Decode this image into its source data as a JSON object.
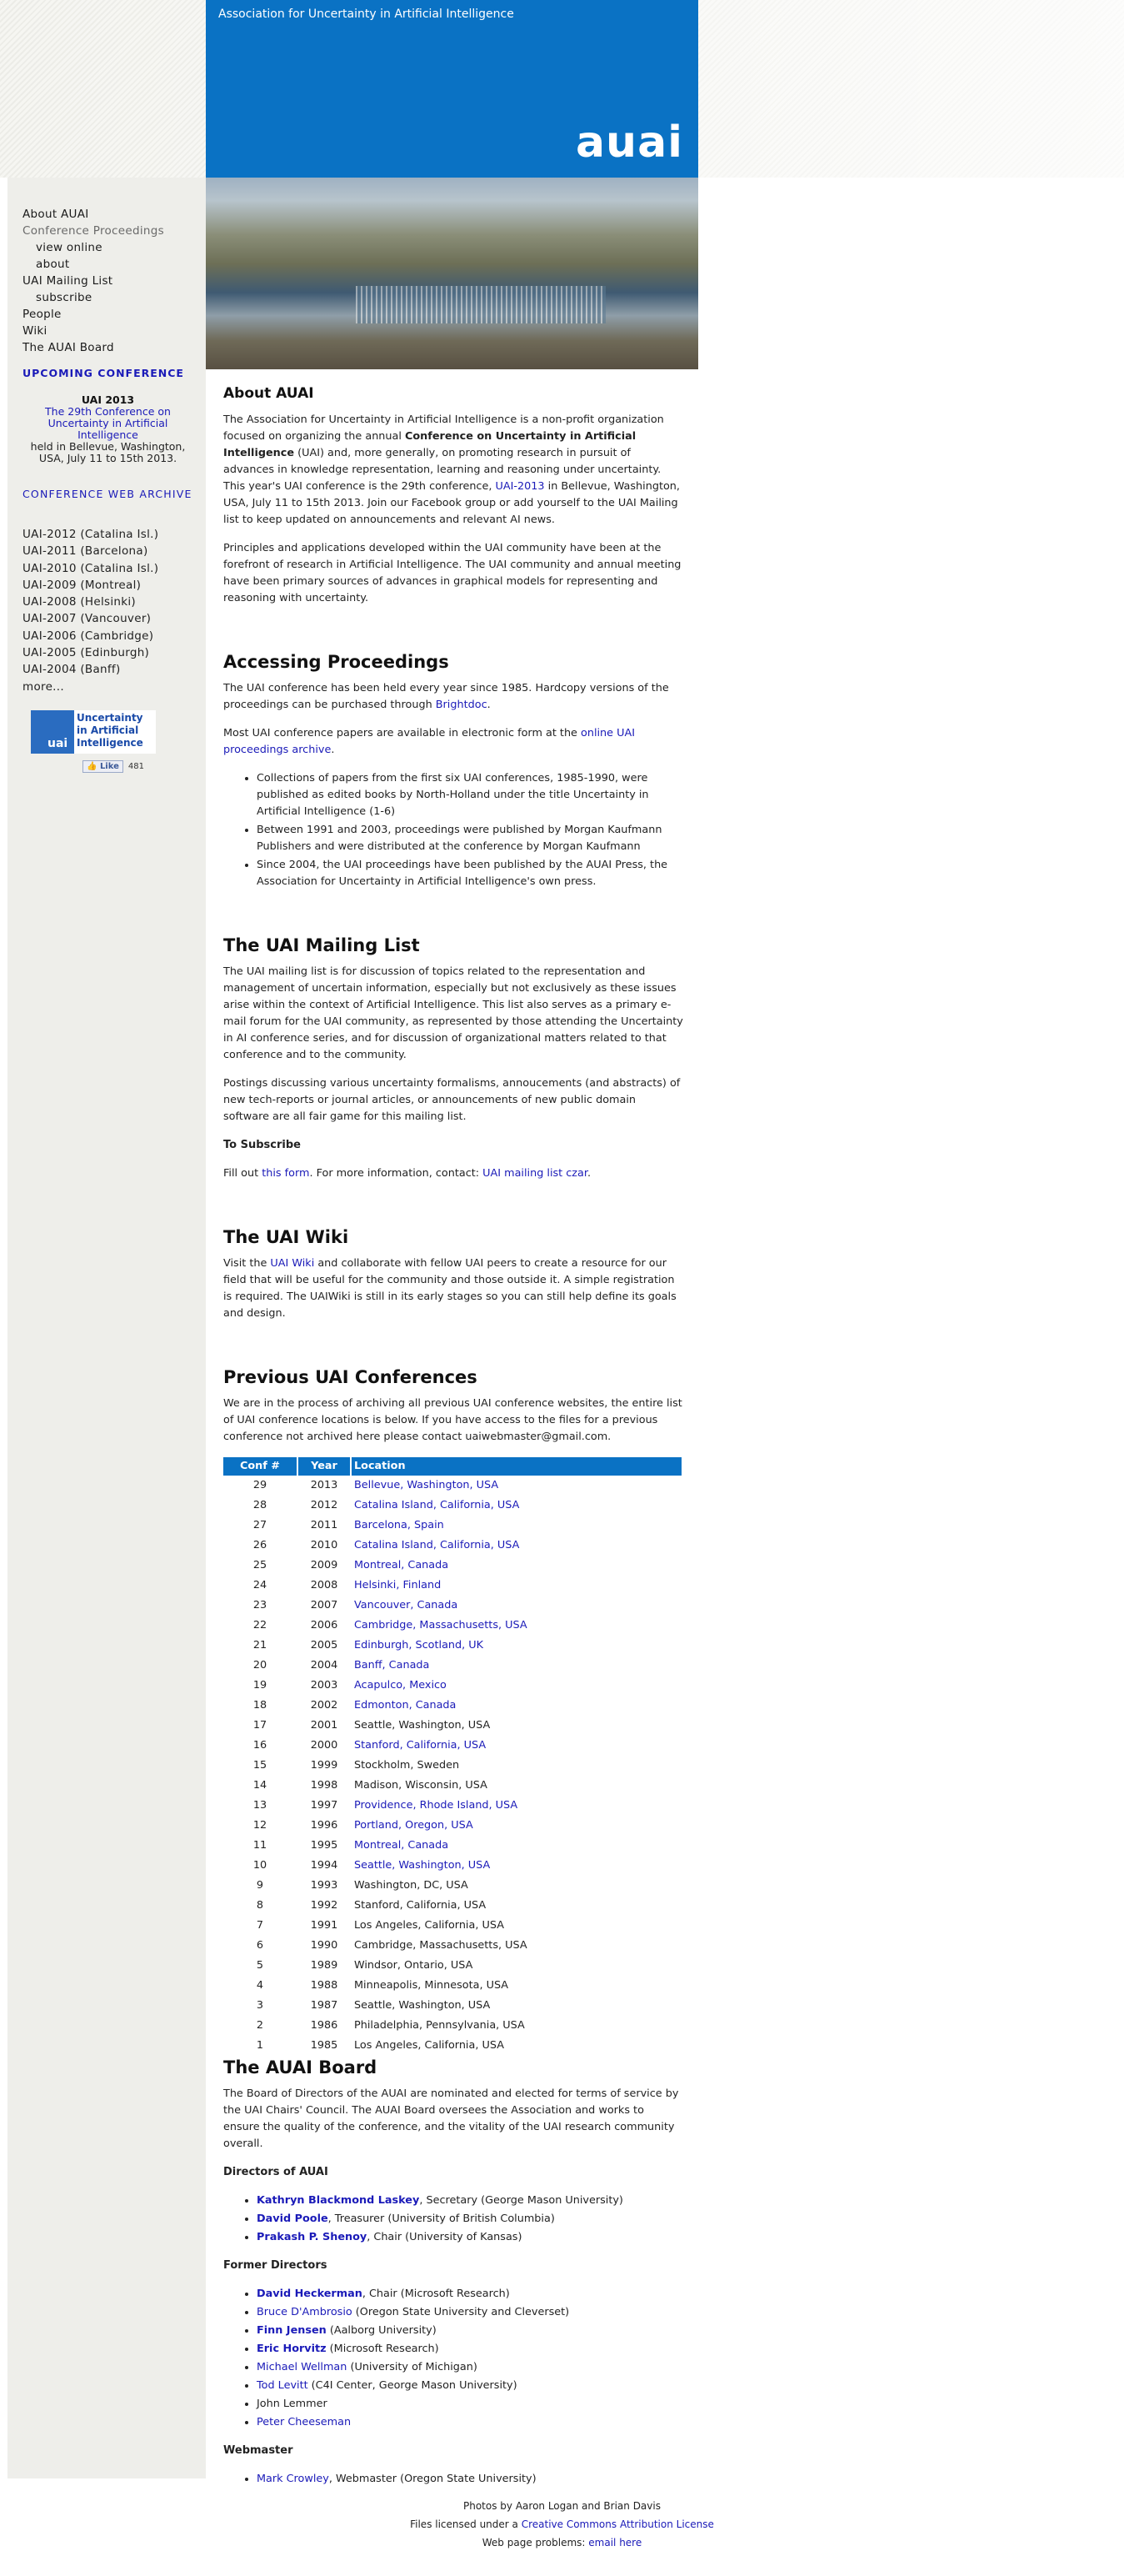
{
  "header": {
    "tagline": "Association for Uncertainty in Artificial Intelligence",
    "logo": "auai"
  },
  "nav": [
    {
      "label": "About AUAI",
      "indent": 0,
      "dim": false
    },
    {
      "label": "Conference Proceedings",
      "indent": 0,
      "dim": true
    },
    {
      "label": "view online",
      "indent": 1,
      "dim": false
    },
    {
      "label": "about",
      "indent": 1,
      "dim": false
    },
    {
      "label": "UAI Mailing List",
      "indent": 0,
      "dim": false
    },
    {
      "label": "subscribe",
      "indent": 1,
      "dim": false
    },
    {
      "label": "People",
      "indent": 0,
      "dim": false
    },
    {
      "label": "Wiki",
      "indent": 0,
      "dim": false
    },
    {
      "label": "The AUAI Board",
      "indent": 0,
      "dim": false
    }
  ],
  "upcoming": {
    "heading": "UPCOMING CONFERENCE",
    "title": "UAI 2013",
    "link": "The 29th Conference on Uncertainty in Artificial Intelligence",
    "details": "held in Bellevue, Washington, USA, July 11 to 15th 2013."
  },
  "archive": {
    "heading": "CONFERENCE WEB ARCHIVE",
    "items": [
      "UAI-2012 (Catalina Isl.)",
      "UAI-2011 (Barcelona)",
      "UAI-2010 (Catalina Isl.)",
      "UAI-2009 (Montreal)",
      "UAI-2008 (Helsinki)",
      "UAI-2007 (Vancouver)",
      "UAI-2006 (Cambridge)",
      "UAI-2005 (Edinburgh)",
      "UAI-2004 (Banff)",
      "more..."
    ]
  },
  "facebook": {
    "logo": "uai",
    "name": "Uncertainty in Artificial Intelligence",
    "like": "Like",
    "count": "481"
  },
  "about": {
    "title": "About AUAI",
    "p1a": "The Association for Uncertainty in Artificial Intelligence is a non-profit organization focused on organizing the annual ",
    "p1b": "Conference on Uncertainty in Artificial Intelligence",
    "p1c": " (UAI) and, more generally, on promoting research in pursuit of advances in knowledge representation, learning and reasoning under uncertainty. This year's UAI conference is the 29th conference, ",
    "p1link": "UAI-2013",
    "p1d": " in Bellevue, Washington, USA, July 11 to 15th 2013. Join our Facebook group or add yourself to the UAI Mailing list to keep updated on announcements and relevant AI news.",
    "p2": "Principles and applications developed within the UAI community have been at the forefront of research in Artificial Intelligence. The UAI community and annual meeting have been primary sources of advances in graphical models for representing and reasoning with uncertainty."
  },
  "proceedings": {
    "title": "Accessing Proceedings",
    "p1a": "The UAI conference has been held every year since 1985. Hardcopy versions of the proceedings can be purchased through ",
    "p1link": "Brightdoc",
    "p1b": ".",
    "p2a": "Most UAI conference papers are available in electronic form at the ",
    "p2link": "online UAI proceedings archive",
    "p2b": ".",
    "bullets": [
      "Collections of papers from the first six UAI conferences, 1985-1990, were published as edited books by North-Holland under the title Uncertainty in Artificial Intelligence (1-6)",
      "Between 1991 and 2003, proceedings were published by Morgan Kaufmann Publishers and were distributed at the conference by Morgan Kaufmann",
      "Since 2004, the UAI proceedings have been published by the AUAI Press, the Association for Uncertainty in Artificial Intelligence's own press."
    ]
  },
  "mailing": {
    "title": "The UAI Mailing List",
    "p1": "The UAI mailing list is for discussion of topics related to the representation and management of uncertain information, especially but not exclusively as these issues arise within the context of Artificial Intelligence. This list also serves as a primary e-mail forum for the UAI community, as represented by those attending the Uncertainty in AI conference series, and for discussion of organizational matters related to that conference and to the community.",
    "p2": "Postings discussing various uncertainty formalisms, annoucements (and abstracts) of new tech-reports or journal articles, or announcements of new public domain software are all fair game for this mailing list.",
    "sub_heading": "To Subscribe",
    "s1": "Fill out ",
    "s_link1": "this form",
    "s2": ". For more information, contact: ",
    "s_link2": "UAI mailing list czar",
    "s3": "."
  },
  "wiki": {
    "title": "The UAI Wiki",
    "a": "Visit the ",
    "link": "UAI Wiki",
    "b": " and collaborate with fellow UAI peers to create a resource for our field that will be useful for the community and those outside it. A simple registration is required. The UAIWiki is still in its early stages so you can still help define its goals and design."
  },
  "previous": {
    "title": "Previous UAI Conferences",
    "p": "We are in the process of archiving all previous UAI conference websites, the entire list of UAI conference locations is below. If you have access to the files for a previous conference not archived here please contact uaiwebmaster@gmail.com.",
    "headers": [
      "Conf #",
      "Year",
      "Location"
    ],
    "rows": [
      {
        "n": "29",
        "y": "2013",
        "loc": "Bellevue, Washington, USA",
        "link": true
      },
      {
        "n": "28",
        "y": "2012",
        "loc": "Catalina Island, California, USA",
        "link": true
      },
      {
        "n": "27",
        "y": "2011",
        "loc": "Barcelona, Spain",
        "link": true
      },
      {
        "n": "26",
        "y": "2010",
        "loc": "Catalina Island, California, USA",
        "link": true
      },
      {
        "n": "25",
        "y": "2009",
        "loc": "Montreal, Canada",
        "link": true
      },
      {
        "n": "24",
        "y": "2008",
        "loc": "Helsinki, Finland",
        "link": true
      },
      {
        "n": "23",
        "y": "2007",
        "loc": "Vancouver, Canada",
        "link": true
      },
      {
        "n": "22",
        "y": "2006",
        "loc": "Cambridge, Massachusetts, USA",
        "link": true
      },
      {
        "n": "21",
        "y": "2005",
        "loc": "Edinburgh, Scotland, UK",
        "link": true
      },
      {
        "n": "20",
        "y": "2004",
        "loc": "Banff, Canada",
        "link": true
      },
      {
        "n": "19",
        "y": "2003",
        "loc": "Acapulco, Mexico",
        "link": true
      },
      {
        "n": "18",
        "y": "2002",
        "loc": "Edmonton, Canada",
        "link": true
      },
      {
        "n": "17",
        "y": "2001",
        "loc": "Seattle, Washington, USA",
        "link": false
      },
      {
        "n": "16",
        "y": "2000",
        "loc": "Stanford, California, USA",
        "link": true
      },
      {
        "n": "15",
        "y": "1999",
        "loc": "Stockholm, Sweden",
        "link": false
      },
      {
        "n": "14",
        "y": "1998",
        "loc": "Madison, Wisconsin, USA",
        "link": false
      },
      {
        "n": "13",
        "y": "1997",
        "loc": "Providence, Rhode Island, USA",
        "link": true
      },
      {
        "n": "12",
        "y": "1996",
        "loc": "Portland, Oregon, USA",
        "link": true
      },
      {
        "n": "11",
        "y": "1995",
        "loc": "Montreal, Canada",
        "link": true
      },
      {
        "n": "10",
        "y": "1994",
        "loc": "Seattle, Washington, USA",
        "link": true
      },
      {
        "n": "9",
        "y": "1993",
        "loc": "Washington, DC, USA",
        "link": false
      },
      {
        "n": "8",
        "y": "1992",
        "loc": "Stanford, California, USA",
        "link": false
      },
      {
        "n": "7",
        "y": "1991",
        "loc": "Los Angeles, California, USA",
        "link": false
      },
      {
        "n": "6",
        "y": "1990",
        "loc": "Cambridge, Massachusetts, USA",
        "link": false
      },
      {
        "n": "5",
        "y": "1989",
        "loc": "Windsor, Ontario, USA",
        "link": false
      },
      {
        "n": "4",
        "y": "1988",
        "loc": "Minneapolis, Minnesota, USA",
        "link": false
      },
      {
        "n": "3",
        "y": "1987",
        "loc": "Seattle, Washington, USA",
        "link": false
      },
      {
        "n": "2",
        "y": "1986",
        "loc": "Philadelphia, Pennsylvania, USA",
        "link": false
      },
      {
        "n": "1",
        "y": "1985",
        "loc": "Los Angeles, California, USA",
        "link": false
      }
    ]
  },
  "board": {
    "title": "The AUAI Board",
    "p": "The Board of Directors of the AUAI are nominated and elected for terms of service by the UAI Chairs' Council. The AUAI Board oversees the Association and works to ensure the quality of the conference, and the vitality of the UAI research community overall.",
    "directors_heading": "Directors of AUAI",
    "directors": [
      {
        "name": "Kathryn Blackmond Laskey",
        "bold": true,
        "link": true,
        "role": ", Secretary (George Mason University)"
      },
      {
        "name": "David Poole",
        "bold": true,
        "link": true,
        "role": ", Treasurer (University of British Columbia)"
      },
      {
        "name": "Prakash P. Shenoy",
        "bold": true,
        "link": true,
        "role": ", Chair (University of Kansas)"
      }
    ],
    "former_heading": "Former Directors",
    "former": [
      {
        "name": "David Heckerman",
        "bold": true,
        "link": true,
        "role": ", Chair (Microsoft Research)"
      },
      {
        "name": "Bruce D'Ambrosio",
        "bold": false,
        "link": true,
        "role": " (Oregon State University and Cleverset)"
      },
      {
        "name": "Finn Jensen",
        "bold": true,
        "link": true,
        "role": " (Aalborg University)"
      },
      {
        "name": "Eric Horvitz",
        "bold": true,
        "link": true,
        "role": " (Microsoft Research)"
      },
      {
        "name": "Michael Wellman",
        "bold": false,
        "link": true,
        "role": " (University of Michigan)"
      },
      {
        "name": "Tod Levitt",
        "bold": false,
        "link": true,
        "role": " (C4I Center, George Mason University)"
      },
      {
        "name": "John Lemmer",
        "bold": false,
        "link": false,
        "role": ""
      },
      {
        "name": "Peter Cheeseman",
        "bold": false,
        "link": true,
        "role": ""
      }
    ],
    "webmaster_heading": "Webmaster",
    "webmaster": [
      {
        "name": "Mark Crowley",
        "bold": false,
        "link": true,
        "role": ", Webmaster (Oregon State University)"
      }
    ]
  },
  "footer": {
    "photos": "Photos by Aaron Logan and Brian Davis",
    "license_a": "Files licensed under a ",
    "license_link": "Creative Commons Attribution License",
    "problems_a": "Web page problems: ",
    "problems_link": "email here"
  }
}
